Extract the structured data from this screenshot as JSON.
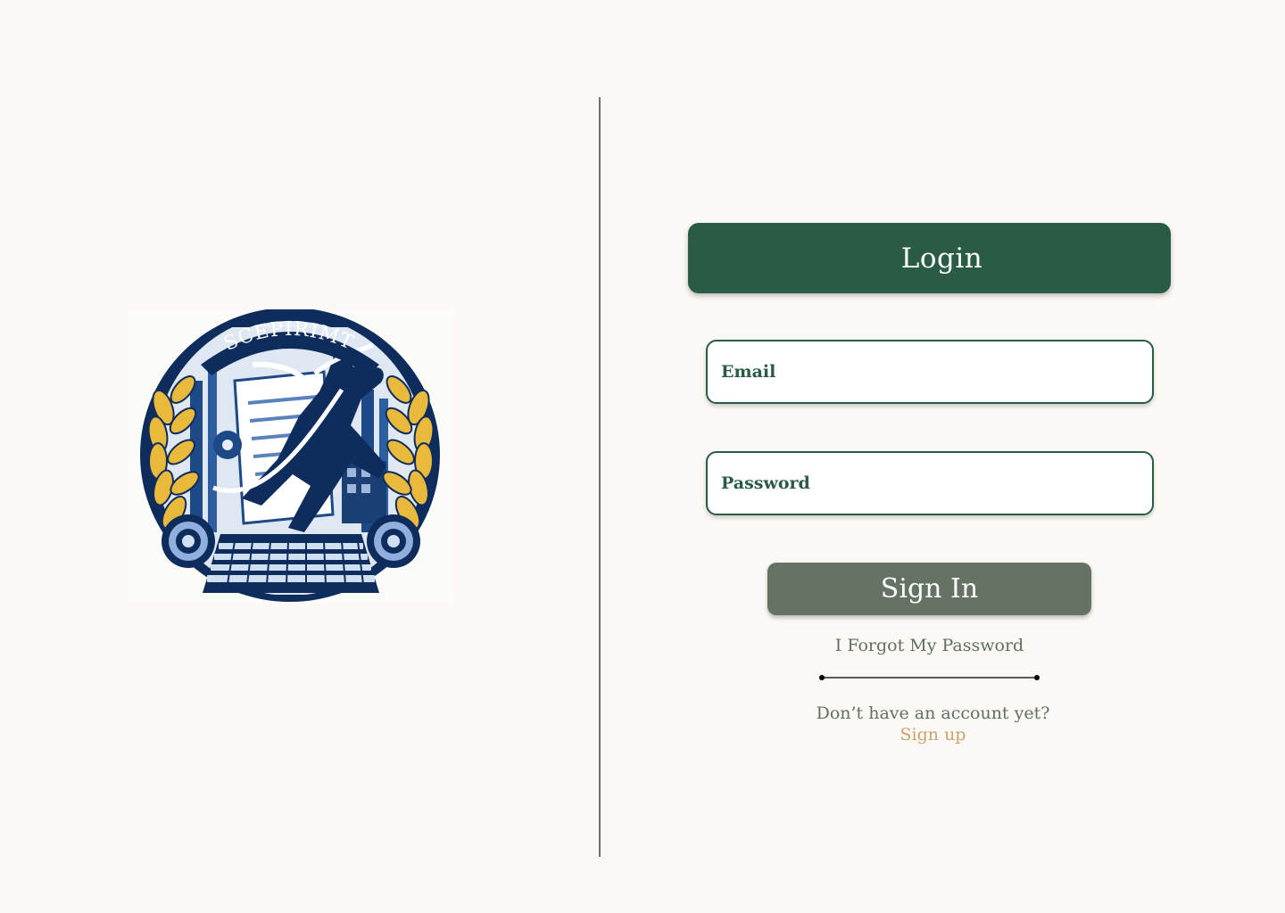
{
  "login": {
    "title": "Login",
    "email_placeholder": "Email",
    "password_placeholder": "Password",
    "signin_label": "Sign In",
    "forgot_label": "I Forgot My Password",
    "no_account_text": "Don’t have an account yet?",
    "signup_label": "Sign up"
  },
  "logo": {
    "icon": "runner-emblem-logo",
    "text": "SCEPIRIMT"
  },
  "colors": {
    "background": "#fcf8f5",
    "primary_green": "#2a5c45",
    "button_gray_green": "#647363",
    "muted_text": "#5f6f60",
    "link_gold": "#c9a36a",
    "logo_navy": "#0f2d5c",
    "logo_gold": "#e8b93b"
  }
}
